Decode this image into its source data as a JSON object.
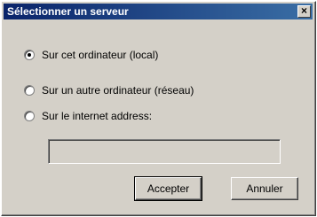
{
  "window": {
    "title": "Sélectionner un serveur",
    "close_label": "×"
  },
  "options": [
    {
      "label": "Sur cet ordinateur (local)",
      "checked": true
    },
    {
      "label": "Sur un autre ordinateur (réseau)",
      "checked": false
    },
    {
      "label": "Sur le internet address:",
      "checked": false
    }
  ],
  "address_input": {
    "value": ""
  },
  "buttons": {
    "accept_label": "Accepter",
    "cancel_label": "Annuler"
  }
}
